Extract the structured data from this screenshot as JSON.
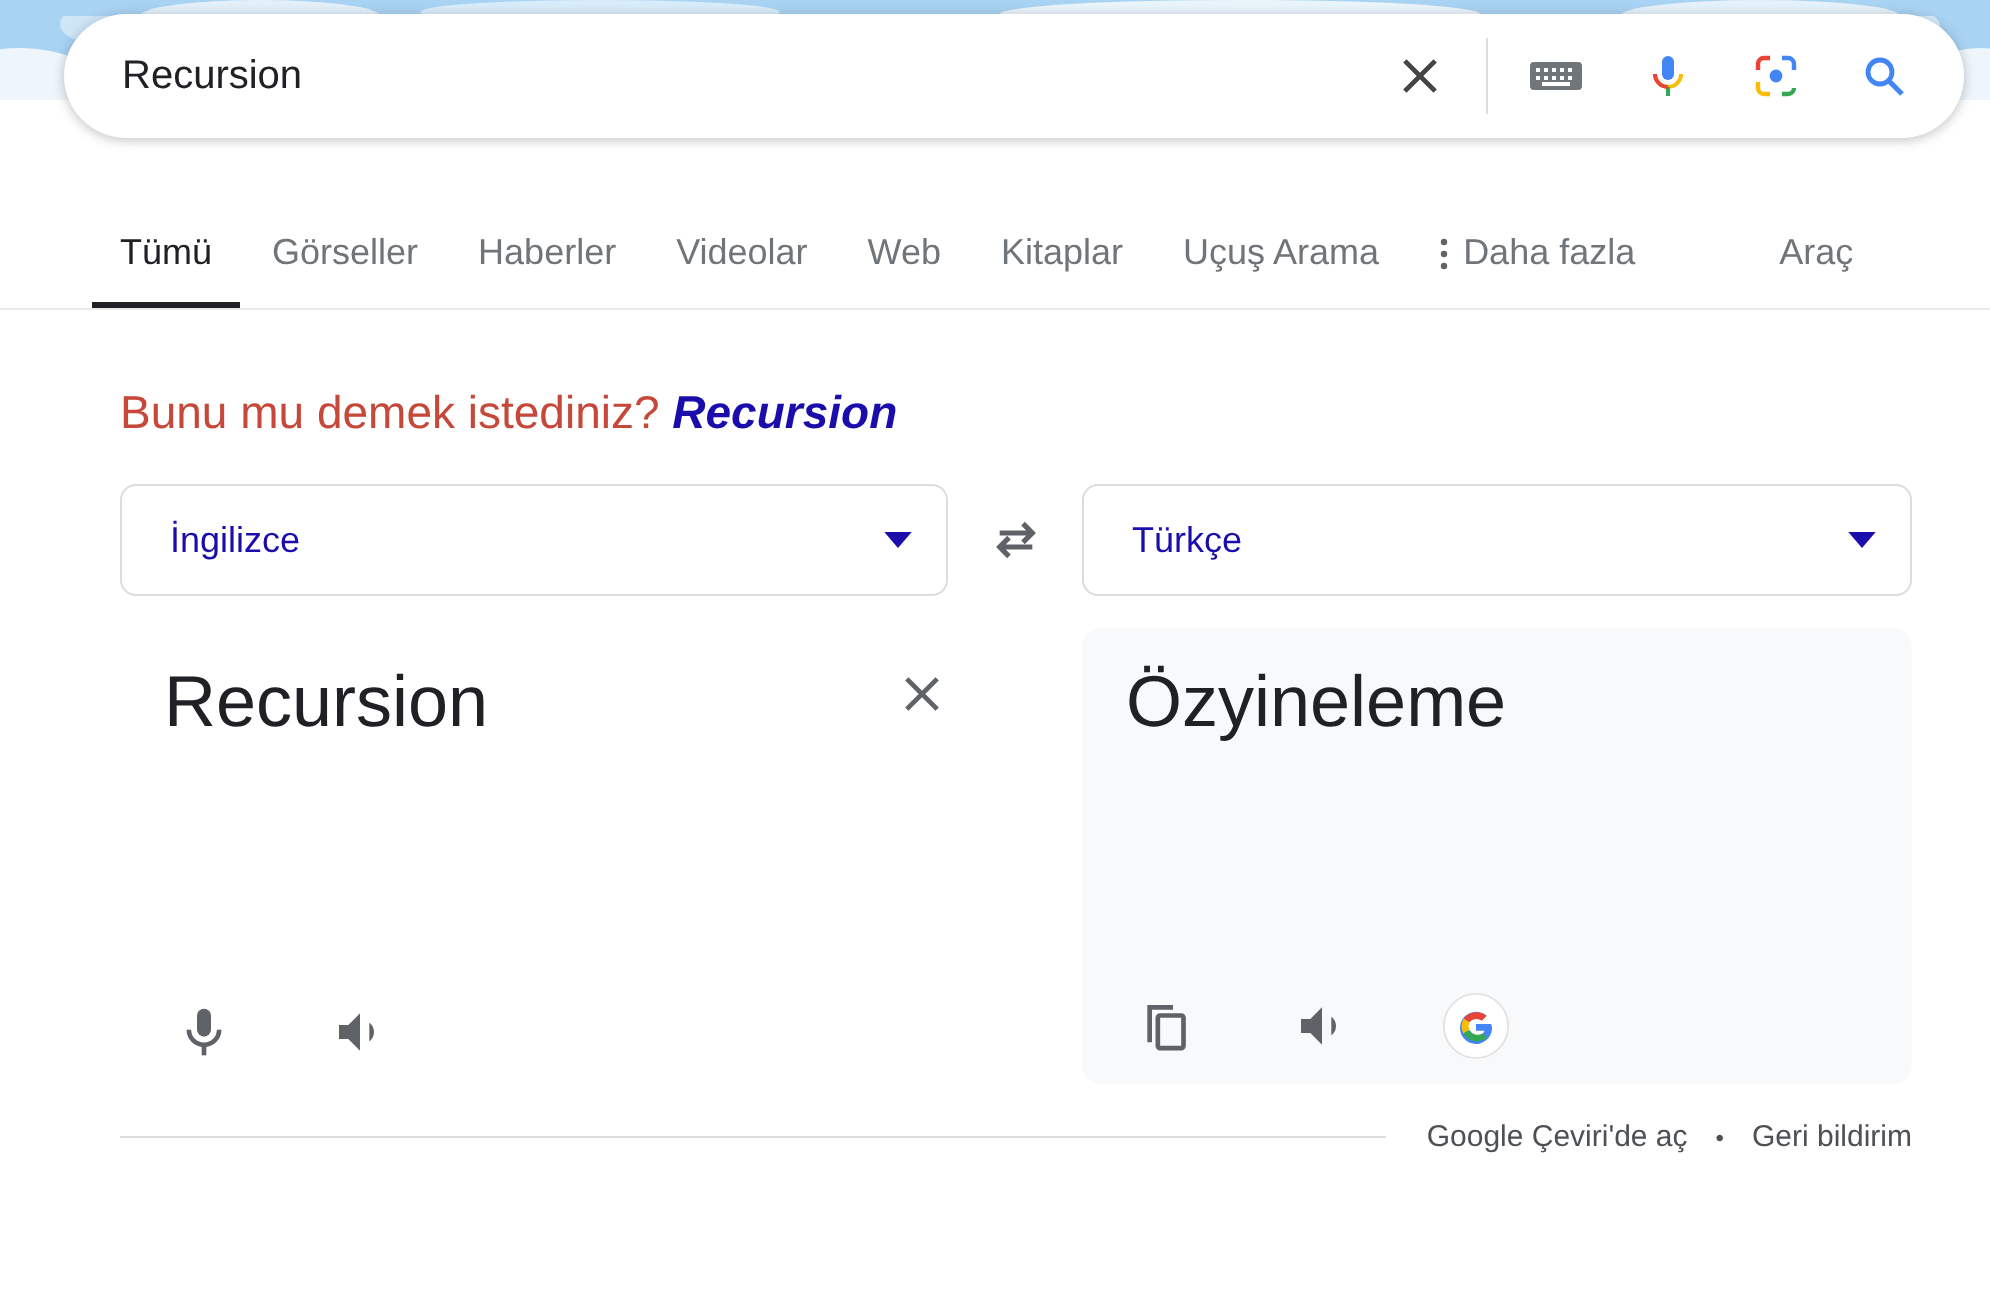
{
  "search": {
    "value": "Recursion"
  },
  "tabs": [
    {
      "label": "Tümü",
      "selected": true
    },
    {
      "label": "Görseller",
      "selected": false
    },
    {
      "label": "Haberler",
      "selected": false
    },
    {
      "label": "Videolar",
      "selected": false
    },
    {
      "label": "Web",
      "selected": false
    },
    {
      "label": "Kitaplar",
      "selected": false
    },
    {
      "label": "Uçuş Arama",
      "selected": false
    },
    {
      "label": "Daha fazla",
      "selected": false,
      "kind": "more"
    },
    {
      "label": "Araç",
      "selected": false
    }
  ],
  "suggestion": {
    "prompt": "Bunu mu demek istediniz?",
    "term": "Recursion"
  },
  "translator": {
    "source_language": "İngilizce",
    "target_language": "Türkçe",
    "source_text": "Recursion",
    "translated_text": "Özyineleme"
  },
  "footer": {
    "links": [
      "Google Çeviri'de aç",
      "Geri bildirim"
    ],
    "separator": "•"
  }
}
